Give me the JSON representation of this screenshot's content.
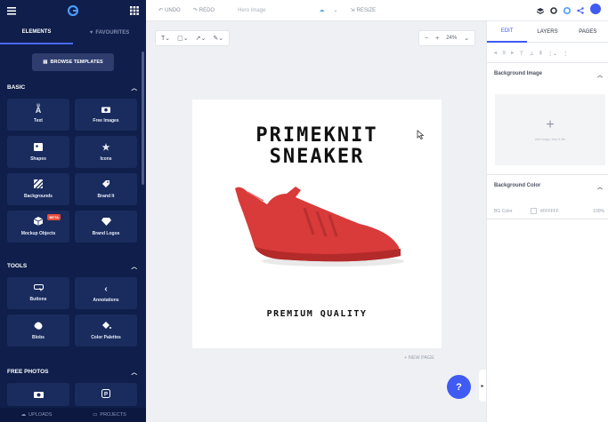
{
  "sidebar": {
    "tabs": [
      {
        "label": "ELEMENTS"
      },
      {
        "label": "FAVOURITES"
      }
    ],
    "browse_button": "BROWSE TEMPLATES",
    "sections": {
      "basic": {
        "title": "BASIC",
        "tiles": [
          {
            "label": "Text",
            "icon": "text-icon"
          },
          {
            "label": "Free Images",
            "icon": "camera-icon"
          },
          {
            "label": "Shapes",
            "icon": "shapes-icon"
          },
          {
            "label": "Icons",
            "icon": "star-icon"
          },
          {
            "label": "Backgrounds",
            "icon": "backgrounds-icon"
          },
          {
            "label": "Brand It",
            "icon": "tag-icon"
          },
          {
            "label": "Mockup Objects",
            "icon": "cube-icon",
            "badge": "BETA"
          },
          {
            "label": "Brand Logos",
            "icon": "diamond-icon"
          }
        ]
      },
      "tools": {
        "title": "TOOLS",
        "tiles": [
          {
            "label": "Buttons",
            "icon": "button-icon"
          },
          {
            "label": "Annotations",
            "icon": "chevron-left-icon"
          },
          {
            "label": "Blobs",
            "icon": "blob-icon"
          },
          {
            "label": "Color Palettes",
            "icon": "paint-bucket-icon"
          }
        ]
      },
      "free_photos": {
        "title": "FREE PHOTOS"
      }
    },
    "bottom": {
      "uploads": "UPLOADS",
      "projects": "PROJECTS"
    }
  },
  "topbar": {
    "undo": "UNDO",
    "redo": "REDO",
    "doc_title": "Hero Image",
    "resize": "RESIZE"
  },
  "canvas": {
    "zoom": "24%",
    "title_line1": "PRIMEKNIT",
    "title_line2": "SNEAKER",
    "subtitle": "PREMIUM QUALITY",
    "new_page": "+ NEW PAGE",
    "help": "?"
  },
  "right_panel": {
    "tabs": [
      {
        "label": "EDIT"
      },
      {
        "label": "LAYERS"
      },
      {
        "label": "PAGES"
      }
    ],
    "background_image": {
      "title": "Background Image",
      "hint": "Add image, Max 8 Mb"
    },
    "background_color": {
      "title": "Background Color",
      "label": "BG Color",
      "hex": "#FFFFFF",
      "opacity": "100%"
    }
  },
  "colors": {
    "sidebar": "#0f1e4a",
    "accent": "#3f5bf2",
    "shoe": "#d93a3a"
  }
}
